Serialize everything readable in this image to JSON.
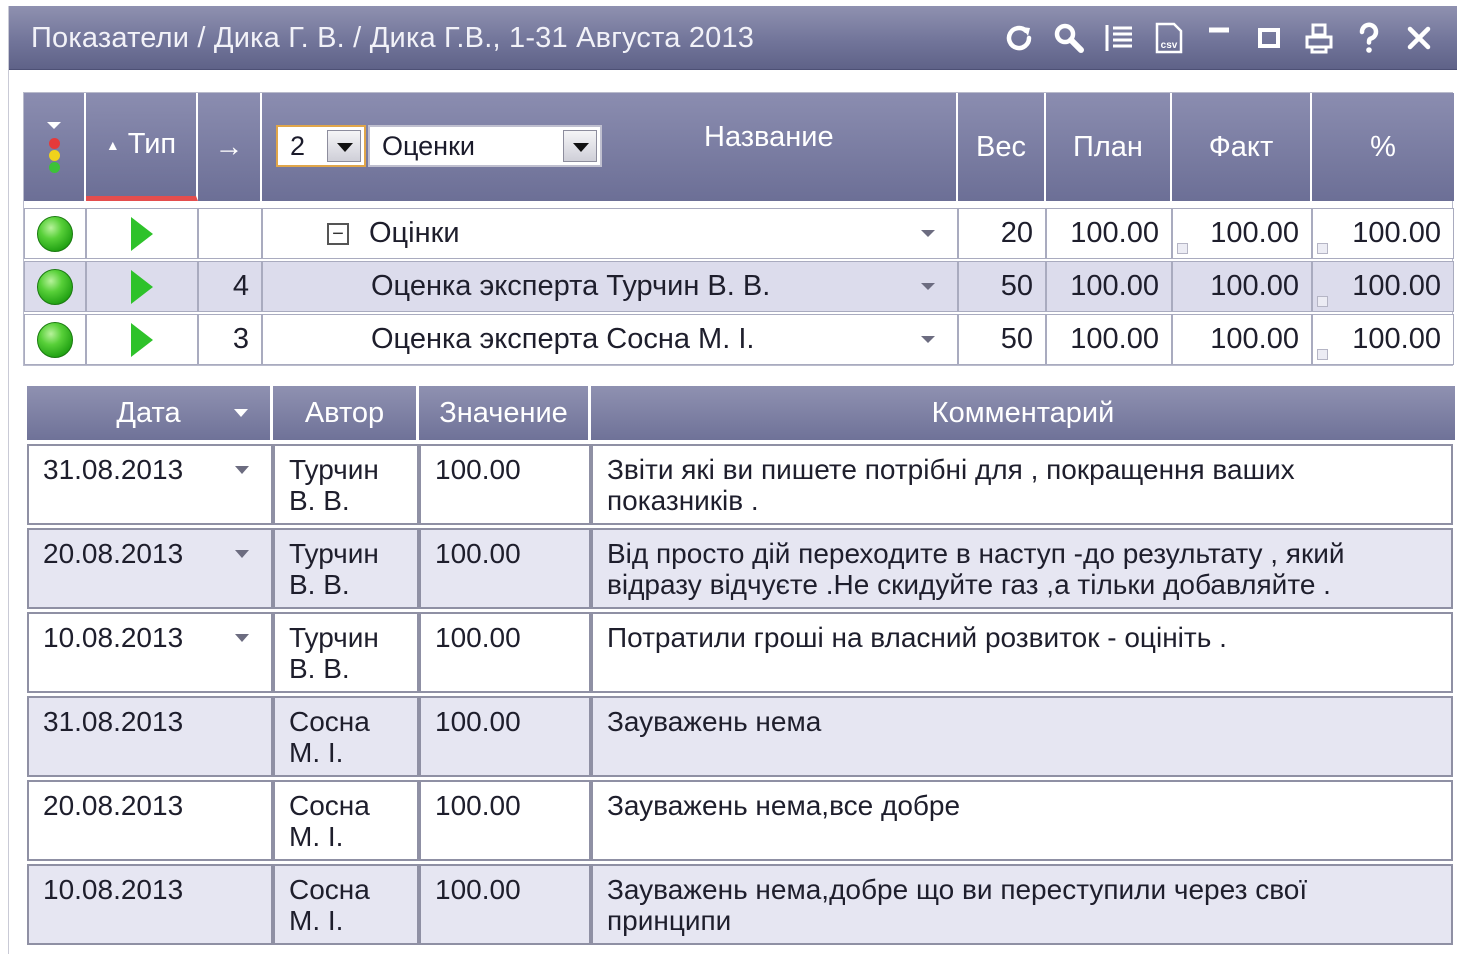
{
  "window": {
    "title": "Показатели / Дика Г. В. / Дика Г.В., 1-31 Августа 2013",
    "toolbar_icons": [
      "refresh-icon",
      "search-icon",
      "list-icon",
      "csv-icon",
      "minimize-icon",
      "maximize-icon",
      "print-icon",
      "help-icon",
      "close-icon"
    ]
  },
  "indicators_grid": {
    "headers": {
      "status": "",
      "type": "Тип",
      "arrow": "→",
      "name": "Название",
      "weight": "Вес",
      "plan": "План",
      "fact": "Факт",
      "percent": "%"
    },
    "level_select": {
      "value": "2"
    },
    "group_select": {
      "value": "Оценки"
    },
    "rows": [
      {
        "order": "",
        "name": "Оцінки",
        "weight": "20",
        "plan": "100.00",
        "fact": "100.00",
        "percent": "100.00",
        "expandable": true
      },
      {
        "order": "4",
        "name": "Оценка эксперта Турчин В. В.",
        "weight": "50",
        "plan": "100.00",
        "fact": "100.00",
        "percent": "100.00"
      },
      {
        "order": "3",
        "name": "Оценка эксперта Сосна М. І.",
        "weight": "50",
        "plan": "100.00",
        "fact": "100.00",
        "percent": "100.00"
      }
    ],
    "colors": {
      "status_ok": "#2ec22a",
      "sort_indicator": "#e44d4d",
      "header": "#7b7ea3"
    }
  },
  "details_grid": {
    "headers": {
      "date": "Дата",
      "author": "Автор",
      "value": "Значение",
      "comment": "Комментарий"
    },
    "rows": [
      {
        "date": "31.08.2013",
        "author": "Турчин В. В.",
        "value": "100.00",
        "comment": "Звіти які ви пишете потрібні для , покращення ваших показників .",
        "dropdown": true
      },
      {
        "date": "20.08.2013",
        "author": "Турчин В. В.",
        "value": "100.00",
        "comment": "Від просто дій переходите в наступ -до результату , який відразу відчуєте .Не скидуйте газ ,а тільки добавляйте .",
        "dropdown": true
      },
      {
        "date": "10.08.2013",
        "author": "Турчин В. В.",
        "value": "100.00",
        "comment": "Потратили гроші на власний розвиток - оцініть .",
        "dropdown": true
      },
      {
        "date": "31.08.2013",
        "author": "Сосна М. І.",
        "value": "100.00",
        "comment": "Зауважень нема",
        "dropdown": false
      },
      {
        "date": "20.08.2013",
        "author": "Сосна М. І.",
        "value": "100.00",
        "comment": "Зауважень нема,все добре",
        "dropdown": false
      },
      {
        "date": "10.08.2013",
        "author": "Сосна М. І.",
        "value": "100.00",
        "comment": "Зауважень нема,добре що ви переступили через свої принципи",
        "dropdown": false
      }
    ]
  }
}
